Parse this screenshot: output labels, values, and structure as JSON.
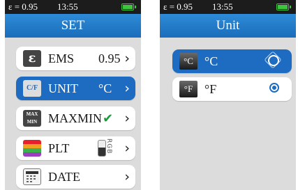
{
  "status": {
    "emissivity": "ε = 0.95",
    "time": "13:55"
  },
  "set_screen": {
    "title": "SET",
    "items": [
      {
        "icon_text": "ε",
        "label": "EMS",
        "value": "0.95"
      },
      {
        "icon_text": "C/F",
        "label": "UNIT",
        "value": "°C"
      },
      {
        "icon_text": "MAX MIN",
        "label": "MAXMIN"
      },
      {
        "icon_text": "",
        "label": "PLT",
        "switch_text": "RGB"
      },
      {
        "icon_text": "",
        "label": "DATE"
      }
    ],
    "chevron": "›"
  },
  "unit_screen": {
    "title": "Unit",
    "options": [
      {
        "icon_text": "°C",
        "label": "°C"
      },
      {
        "icon_text": "°F",
        "label": "°F"
      }
    ]
  },
  "colors": {
    "accent": "#1e6cc2",
    "title_bar": "#2a82d0",
    "check": "#1a9a3a",
    "battery": "#3ec53e"
  },
  "icons": [
    "battery-icon",
    "emissivity-icon",
    "unit-icon",
    "maxmin-icon",
    "palette-icon",
    "calendar-icon",
    "chevron-right-icon",
    "check-icon",
    "radio-icon"
  ]
}
